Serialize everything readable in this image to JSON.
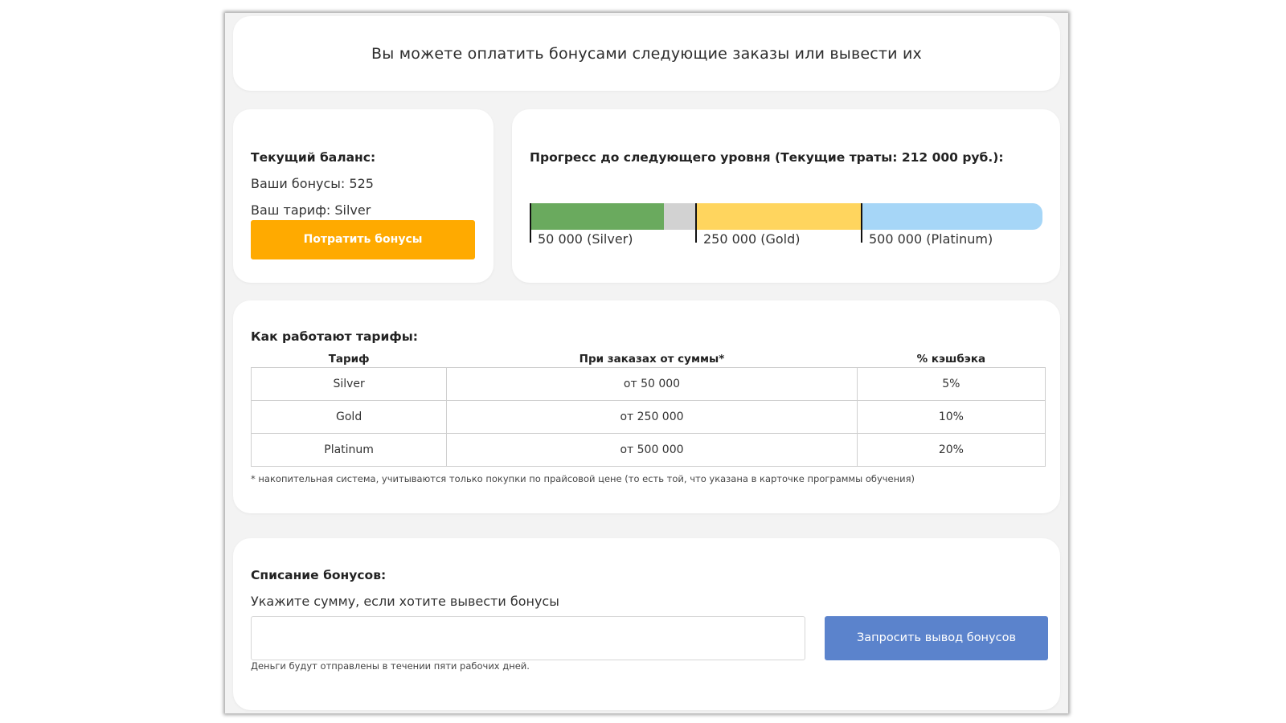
{
  "header": {
    "text": "Вы можете оплатить бонусами следующие заказы или вывести их"
  },
  "balance": {
    "title": "Текущий баланс:",
    "bonus_line": "Ваши бонусы: 525",
    "tariff_line": "Ваш тариф: Silver",
    "spend_button": "Потратить бонусы"
  },
  "progress": {
    "title": "Прогресс до следующего уровня (Текущие траты: 212 000 руб.):",
    "current_spend": 212000,
    "ticks": [
      {
        "label": "50 000 (Silver)",
        "value": 50000
      },
      {
        "label": "250 000 (Gold)",
        "value": 250000
      },
      {
        "label": "500 000 (Platinum)",
        "value": 500000
      }
    ],
    "colors": {
      "reached": "#6aaa5e",
      "pending": "#d2d2d2",
      "gold": "#ffd55e",
      "platinum": "#a6d6f7"
    }
  },
  "tariffs": {
    "title": "Как работают тарифы:",
    "columns": [
      "Тариф",
      "При заказах от суммы*",
      "% кэшбэка"
    ],
    "rows": [
      [
        "Silver",
        "от 50 000",
        "5%"
      ],
      [
        "Gold",
        "от 250 000",
        "10%"
      ],
      [
        "Platinum",
        "от 500 000",
        "20%"
      ]
    ],
    "note": "* накопительная система, учитываются только покупки по прайсовой цене (то есть той, что указана в карточке программы обучения)"
  },
  "withdraw": {
    "title": "Списание бонусов:",
    "subtitle": "Укажите сумму, если хотите вывести бонусы",
    "input_value": "",
    "button": "Запросить вывод бонусов",
    "note": "Деньги будут отправлены в течении пяти рабочих дней."
  },
  "colors": {
    "spend_button": "#ffaa00",
    "withdraw_button": "#5b83cc"
  }
}
